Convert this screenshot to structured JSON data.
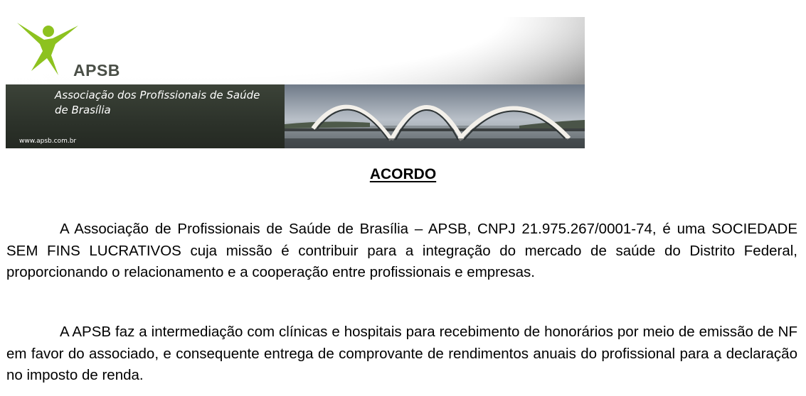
{
  "header": {
    "logo_text": "APSB",
    "org_name_line1": "Associação dos Profissionais de Saúde",
    "org_name_line2": "de Brasília",
    "website": "www.apsb.com.br",
    "logo_icon": "stick-figure-icon",
    "photo": "bridge-photo",
    "colors": {
      "logo_green": "#8dc21f",
      "dark_band": "#2c322a"
    }
  },
  "document": {
    "title": "ACORDO",
    "paragraphs": [
      "A Associação de Profissionais de Saúde de Brasília – APSB, CNPJ 21.975.267/0001-74, é uma SOCIEDADE SEM FINS LUCRATIVOS cuja missão é contribuir para a integração do mercado de saúde do Distrito Federal, proporcionando o relacionamento e a cooperação entre profissionais e empresas.",
      "A APSB faz a intermediação com clínicas e hospitais para recebimento de honorários por meio de emissão de NF em favor do associado, e consequente entrega de comprovante de rendimentos anuais do profissional para a declaração no imposto de renda."
    ]
  }
}
